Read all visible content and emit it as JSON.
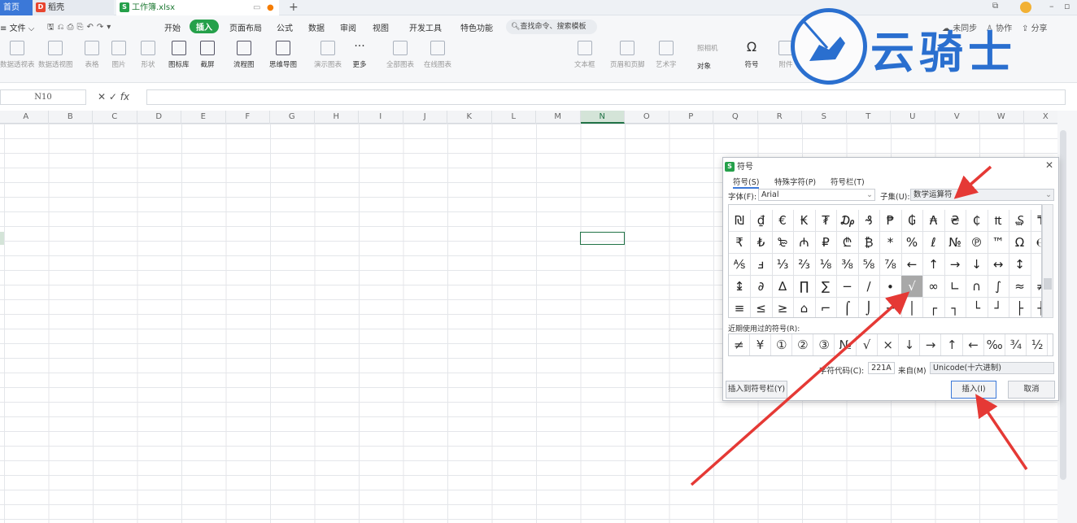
{
  "tabs": {
    "home": "首页",
    "daoke": "稻壳",
    "file": "工作簿.xlsx"
  },
  "menu": {
    "file": "文件",
    "items": [
      "开始",
      "插入",
      "页面布局",
      "公式",
      "数据",
      "审阅",
      "视图",
      "开发工具",
      "特色功能"
    ],
    "search": "查找命令、搜索模板",
    "right": [
      "未同步",
      "协作",
      "分享"
    ]
  },
  "ribbon": [
    "数据透视表",
    "数据透视图",
    "表格",
    "图片",
    "形状",
    "图标库",
    "截屏",
    "流程图",
    "思维导图",
    "演示图表",
    "更多",
    "全部图表",
    "在线图表",
    "文本框",
    "页眉和页脚",
    "艺术字",
    "照相机",
    "对象",
    "符号",
    "附件"
  ],
  "formula": {
    "cell": "N10",
    "fx": "fx",
    "value": ""
  },
  "columns": [
    "A",
    "B",
    "C",
    "D",
    "E",
    "F",
    "G",
    "H",
    "I",
    "J",
    "K",
    "L",
    "M",
    "N",
    "O",
    "P",
    "Q",
    "R",
    "S",
    "T",
    "U",
    "V",
    "W",
    "X"
  ],
  "selected_column": "N",
  "dialog": {
    "title": "符号",
    "tabs": [
      "符号(S)",
      "特殊字符(P)",
      "符号栏(T)"
    ],
    "font_label": "字体(F):",
    "font_value": "Arial",
    "subset_label": "子集(U):",
    "subset_value": "数学运算符",
    "grid": [
      [
        "₪",
        "₫",
        "€",
        "₭",
        "₮",
        "₯",
        "₰",
        "₱",
        "₲",
        "₳",
        "₴",
        "₵",
        "₶",
        "₷",
        "₸"
      ],
      [
        "₹",
        "₺",
        "₻",
        "₼",
        "₽",
        "₾",
        "₿",
        "*",
        "%",
        "ℓ",
        "№",
        "℗",
        "™",
        "Ω",
        "℮"
      ],
      [
        "⅍",
        "ⅎ",
        "⅓",
        "⅔",
        "⅛",
        "⅜",
        "⅝",
        "⅞",
        "←",
        "↑",
        "→",
        "↓",
        "↔",
        "↕"
      ],
      [
        "↨",
        "∂",
        "∆",
        "∏",
        "∑",
        "−",
        "∕",
        "∙",
        "√",
        "∞",
        "∟",
        "∩",
        "∫",
        "≈",
        "≠"
      ],
      [
        "≡",
        "≤",
        "≥",
        "⌂",
        "⌐",
        "⌠",
        "⌡",
        "─",
        "│",
        "┌",
        "┐",
        "└",
        "┘",
        "├",
        "┤"
      ]
    ],
    "highlighted": "√",
    "recent_label": "近期使用过的符号(R):",
    "recent": [
      "≠",
      "¥",
      "①",
      "②",
      "③",
      "№",
      "√",
      "×",
      "↓",
      "→",
      "↑",
      "←",
      "‰",
      "¾",
      "½"
    ],
    "code_label": "字符代码(C):",
    "code_value": "221A",
    "from_label": "来自(M)",
    "from_value": "Unicode(十六进制)",
    "btn_insert_bar": "插入到符号栏(Y)",
    "btn_insert": "插入(I)",
    "btn_cancel": "取消"
  },
  "watermark": "云骑士",
  "colors": {
    "accent": "#3b78d8",
    "green": "#25a04a",
    "arrow": "#e53935"
  }
}
